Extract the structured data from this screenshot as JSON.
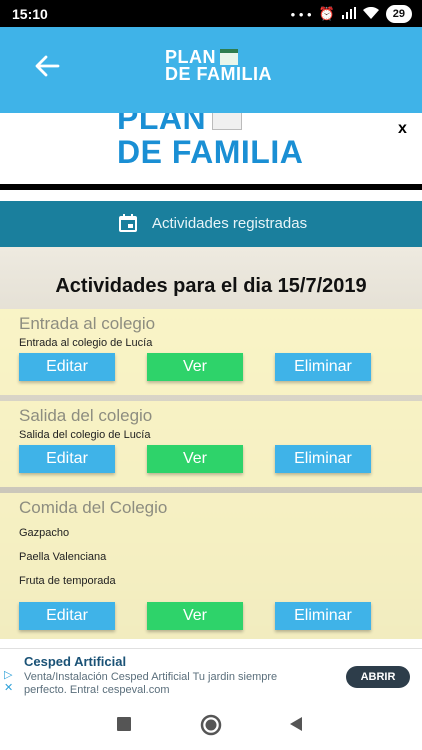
{
  "statusbar": {
    "time": "15:10",
    "dots": "• • •",
    "battery": "29"
  },
  "appbar": {
    "logo_line1": "PLAN",
    "logo_line2": "DE FAMILIA"
  },
  "banner": {
    "logo_line1": "PLAN",
    "logo_line2": "DE FAMILIA",
    "close": "x"
  },
  "section": {
    "label": "Actividades registradas"
  },
  "main": {
    "title": "Actividades para el dia 15/7/2019",
    "activities": [
      {
        "title": "Entrada al colegio",
        "lines": [
          "Entrada al colegio de Lucía"
        ]
      },
      {
        "title": "Salida del colegio",
        "lines": [
          "Salida del colegio de Lucía"
        ]
      },
      {
        "title": "Comida del Colegio",
        "lines": [
          "Gazpacho",
          "Paella Valenciana",
          "Fruta de temporada"
        ]
      }
    ],
    "buttons": {
      "edit": "Editar",
      "view": "Ver",
      "delete": "Eliminar"
    }
  },
  "ad": {
    "title": "Cesped Artificial",
    "description": "Venta/Instalación Cesped Artificial Tu jardin siempre perfecto. Entra! cespeval.com",
    "cta": "ABRIR"
  },
  "colors": {
    "appbar": "#3fb3e8",
    "section": "#1a7f9d",
    "blue_button": "#3fb3e8",
    "green_button": "#2ed36a"
  }
}
